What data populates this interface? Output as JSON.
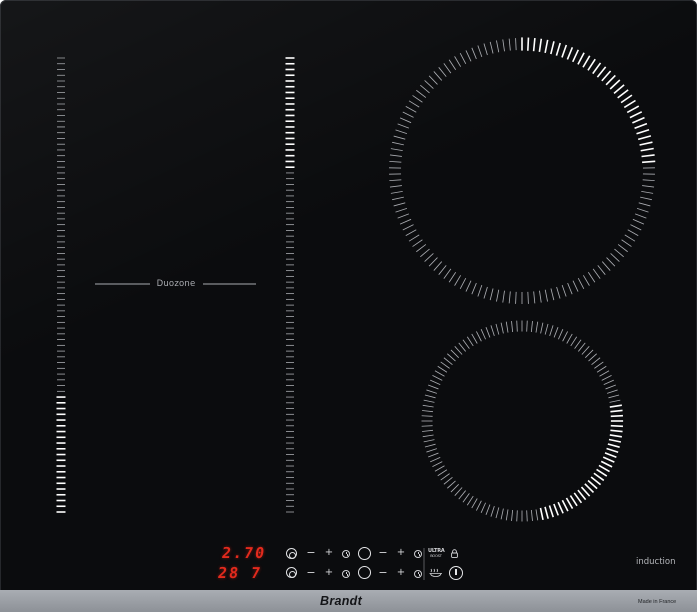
{
  "zones": {
    "duozone_label": "Duozone",
    "induction_label": "induction",
    "left_slider": {
      "levels_total": 80,
      "levels_lit": 21,
      "lit_from": "bottom"
    },
    "middle_slider": {
      "levels_total": 80,
      "levels_lit": 20,
      "lit_from": "top"
    },
    "large_ring": {
      "ticks_total": 130,
      "ticks_lit": 32,
      "lit_arc": "top to right"
    },
    "small_ring": {
      "ticks_total": 120,
      "ticks_lit": 30,
      "lit_arc": "right to bottom"
    }
  },
  "display": {
    "timer_top": "2.70",
    "timer_bottom": "28 7",
    "color": "#e32a1d"
  },
  "controls": {
    "minus": "−",
    "plus": "+",
    "ultra_boost_line1": "ULTRA",
    "ultra_boost_line2": "BOOST",
    "icons": [
      "slider-select-icon",
      "clock-icon",
      "lock-icon",
      "keep-warm-icon",
      "power-icon"
    ]
  },
  "bezel": {
    "brand": "Brandt",
    "made_in": "Made in France"
  },
  "colors": {
    "glass": "#0b0c0e",
    "graphics": "#a9abb0",
    "lit_marks": "#ffffff",
    "bezel": "#9a9ea4"
  }
}
